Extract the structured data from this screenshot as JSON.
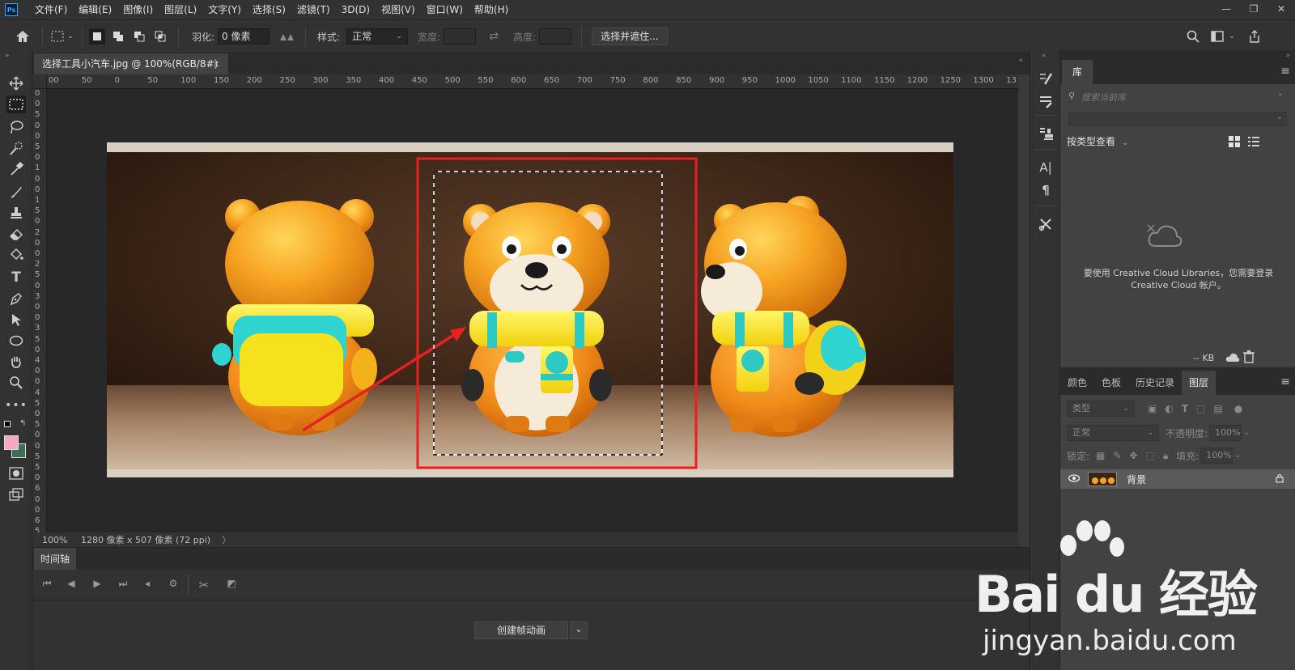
{
  "app": {
    "logo": "Ps"
  },
  "menu": [
    "文件(F)",
    "编辑(E)",
    "图像(I)",
    "图层(L)",
    "文字(Y)",
    "选择(S)",
    "滤镜(T)",
    "3D(D)",
    "视图(V)",
    "窗口(W)",
    "帮助(H)"
  ],
  "window_controls": {
    "minimize": "—",
    "restore": "❐",
    "close": "✕"
  },
  "options": {
    "feather_label": "羽化:",
    "feather_value": "0 像素",
    "style_label": "样式:",
    "style_value": "正常",
    "width_label": "宽度:",
    "height_label": "高度:",
    "select_mask_button": "选择并遮住..."
  },
  "document": {
    "tab_title": "选择工具小汽车.jpg @ 100%(RGB/8#)",
    "tab_close": "×",
    "zoom": "100%",
    "info": "1280 像素 x 507 像素 (72 ppi)",
    "info_arrow": "〉"
  },
  "ruler": {
    "top_labels": [
      "00",
      "50",
      "0",
      "50",
      "100",
      "150",
      "200",
      "250",
      "300",
      "350",
      "400",
      "450",
      "500",
      "550",
      "600",
      "650",
      "700",
      "750",
      "800",
      "850",
      "900",
      "950",
      "1000",
      "1050",
      "1100",
      "1150",
      "1200",
      "1250",
      "1300",
      "13"
    ],
    "left_labels": [
      "0",
      "0",
      "5",
      "0",
      "0",
      "5",
      "0",
      "1",
      "0",
      "0",
      "1",
      "5",
      "0",
      "2",
      "0",
      "0",
      "2",
      "5",
      "0",
      "3",
      "0",
      "0",
      "3",
      "5",
      "0",
      "4",
      "0",
      "0",
      "4",
      "5",
      "0",
      "5",
      "0",
      "0",
      "5",
      "5",
      "0",
      "6",
      "0",
      "0",
      "6",
      "5"
    ]
  },
  "timeline": {
    "tab_label": "时间轴",
    "create_button": "创建帧动画",
    "create_arrow": "⌄"
  },
  "library": {
    "tab_label": "库",
    "search_placeholder": "搜索当前库",
    "view_label": "按类型查看",
    "message": "要使用 Creative Cloud Libraries，您需要登录 Creative Cloud 帐户。",
    "kb_label": "-- KB"
  },
  "layers_panel": {
    "tabs": [
      "颜色",
      "色板",
      "历史记录",
      "图层"
    ],
    "filter_label": "类型",
    "blend_mode": "正常",
    "opacity_label": "不透明度:",
    "opacity_value": "100%",
    "lock_label": "锁定:",
    "fill_label": "填充:",
    "fill_value": "100%",
    "layer_name": "背景"
  },
  "watermark": {
    "brand": "Bai du 经验",
    "url": "jingyan.baidu.com"
  },
  "colors": {
    "foreground": "#f4a9c0",
    "background": "#3e6e5a",
    "annotation_red": "#e82020"
  }
}
